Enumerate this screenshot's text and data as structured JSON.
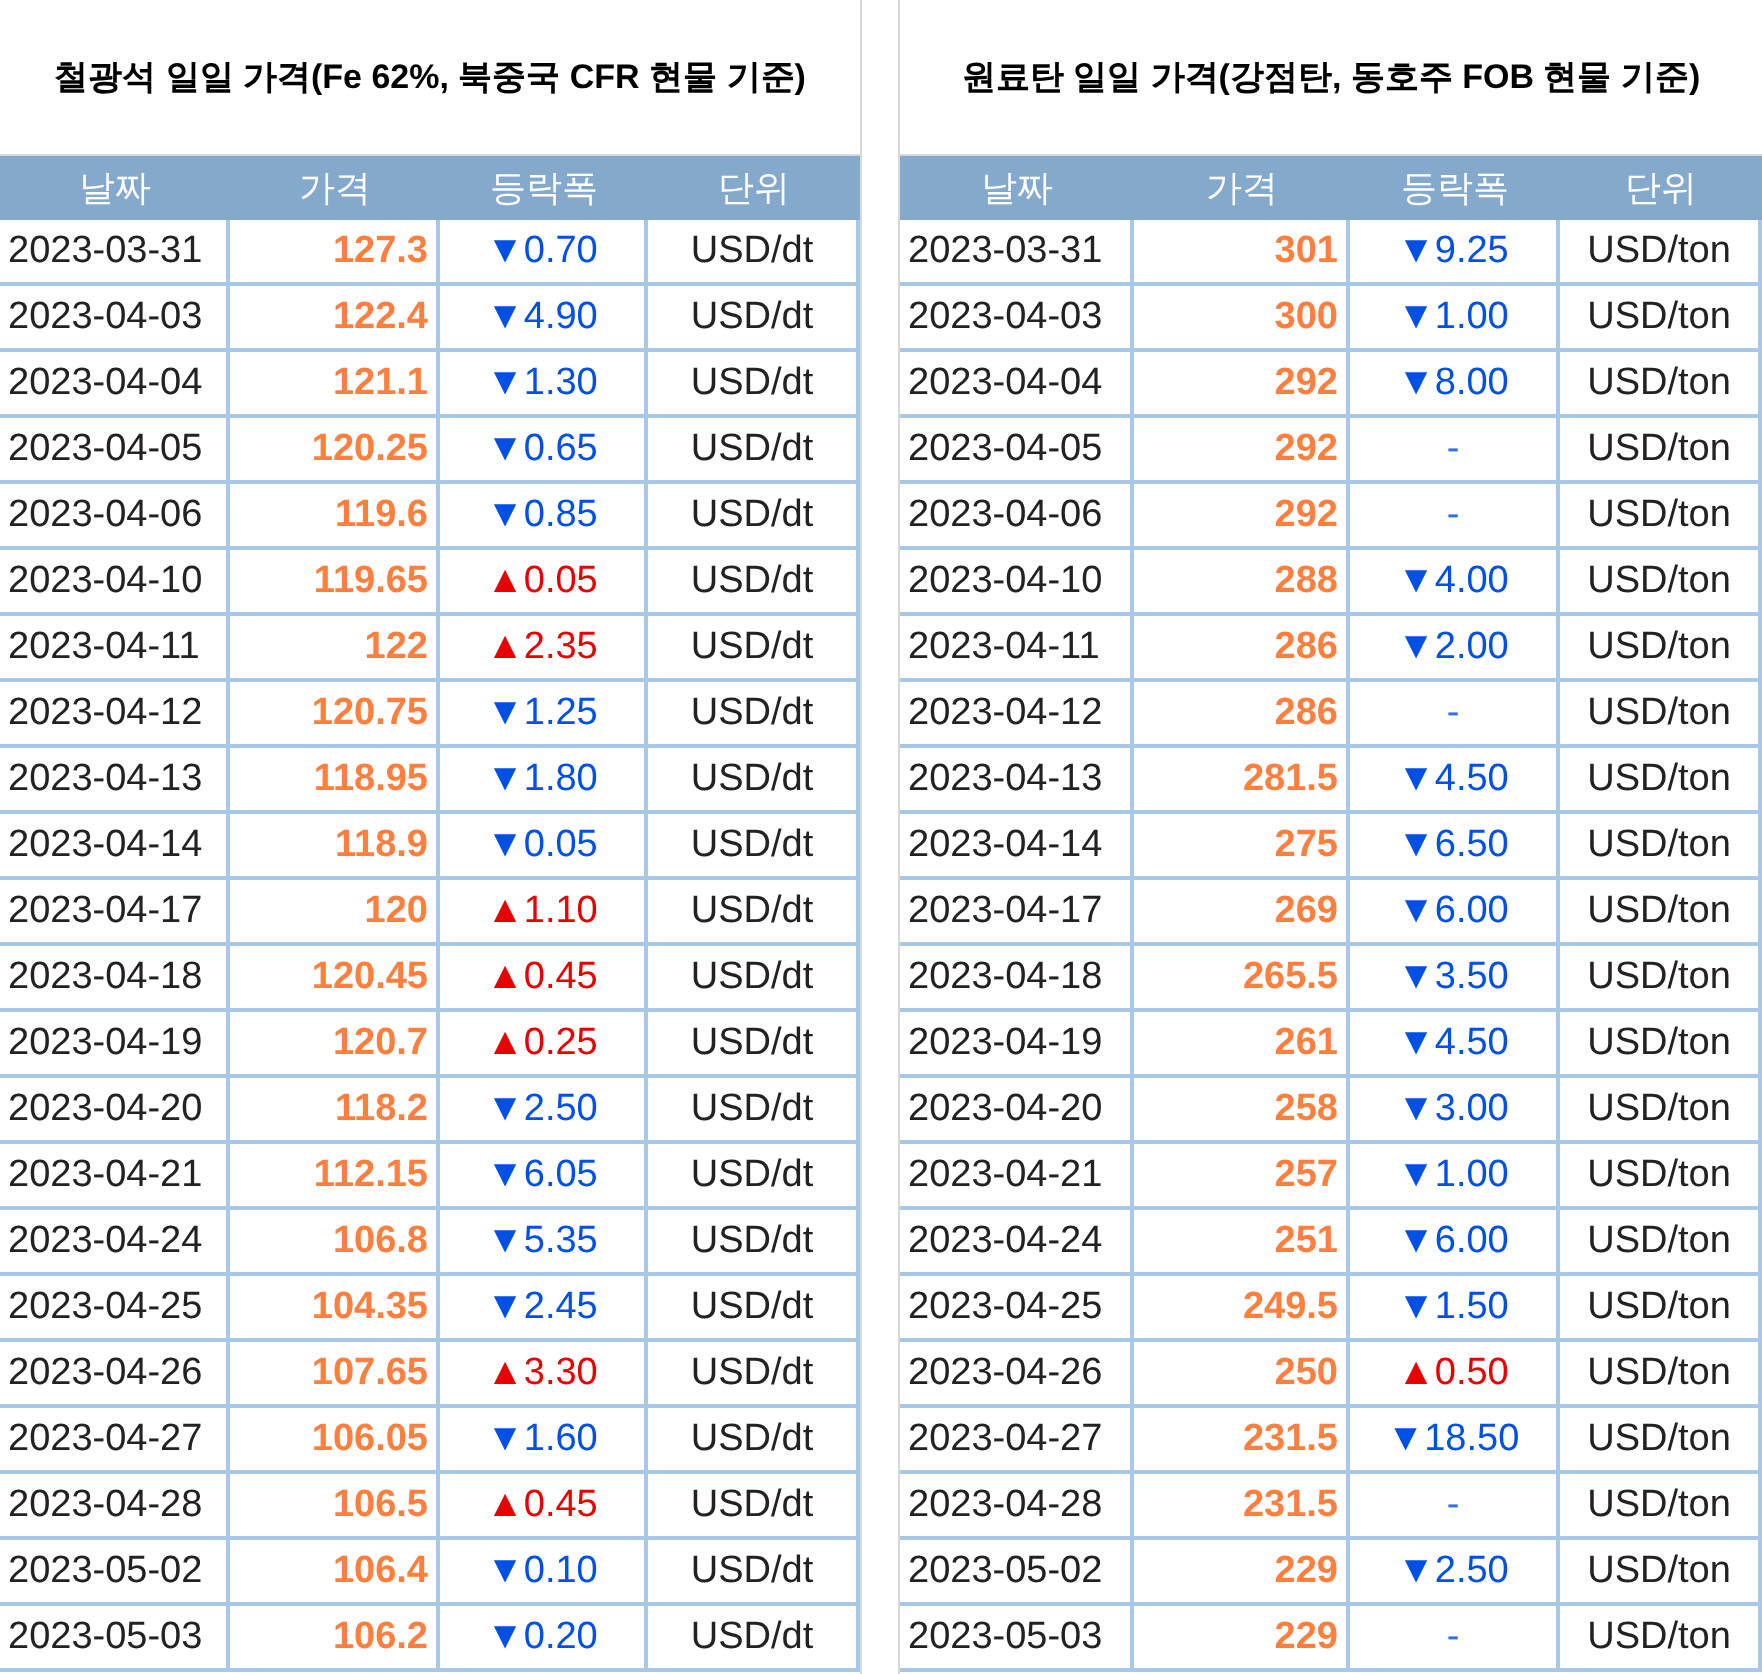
{
  "tables": [
    {
      "title": "철광석 일일 가격(Fe 62%, 북중국 CFR 현물 기준)",
      "columns": [
        "날짜",
        "가격",
        "등락폭",
        "단위"
      ],
      "rows": [
        {
          "date": "2023-03-31",
          "price": "127.3",
          "change": "▼0.70",
          "kind": "down",
          "unit": "USD/dt"
        },
        {
          "date": "2023-04-03",
          "price": "122.4",
          "change": "▼4.90",
          "kind": "down",
          "unit": "USD/dt"
        },
        {
          "date": "2023-04-04",
          "price": "121.1",
          "change": "▼1.30",
          "kind": "down",
          "unit": "USD/dt"
        },
        {
          "date": "2023-04-05",
          "price": "120.25",
          "change": "▼0.65",
          "kind": "down",
          "unit": "USD/dt"
        },
        {
          "date": "2023-04-06",
          "price": "119.6",
          "change": "▼0.85",
          "kind": "down",
          "unit": "USD/dt"
        },
        {
          "date": "2023-04-10",
          "price": "119.65",
          "change": "▲0.05",
          "kind": "up",
          "unit": "USD/dt"
        },
        {
          "date": "2023-04-11",
          "price": "122",
          "change": "▲2.35",
          "kind": "up",
          "unit": "USD/dt"
        },
        {
          "date": "2023-04-12",
          "price": "120.75",
          "change": "▼1.25",
          "kind": "down",
          "unit": "USD/dt"
        },
        {
          "date": "2023-04-13",
          "price": "118.95",
          "change": "▼1.80",
          "kind": "down",
          "unit": "USD/dt"
        },
        {
          "date": "2023-04-14",
          "price": "118.9",
          "change": "▼0.05",
          "kind": "down",
          "unit": "USD/dt"
        },
        {
          "date": "2023-04-17",
          "price": "120",
          "change": "▲1.10",
          "kind": "up",
          "unit": "USD/dt"
        },
        {
          "date": "2023-04-18",
          "price": "120.45",
          "change": "▲0.45",
          "kind": "up",
          "unit": "USD/dt"
        },
        {
          "date": "2023-04-19",
          "price": "120.7",
          "change": "▲0.25",
          "kind": "up",
          "unit": "USD/dt"
        },
        {
          "date": "2023-04-20",
          "price": "118.2",
          "change": "▼2.50",
          "kind": "down",
          "unit": "USD/dt"
        },
        {
          "date": "2023-04-21",
          "price": "112.15",
          "change": "▼6.05",
          "kind": "down",
          "unit": "USD/dt"
        },
        {
          "date": "2023-04-24",
          "price": "106.8",
          "change": "▼5.35",
          "kind": "down",
          "unit": "USD/dt"
        },
        {
          "date": "2023-04-25",
          "price": "104.35",
          "change": "▼2.45",
          "kind": "down",
          "unit": "USD/dt"
        },
        {
          "date": "2023-04-26",
          "price": "107.65",
          "change": "▲3.30",
          "kind": "up",
          "unit": "USD/dt"
        },
        {
          "date": "2023-04-27",
          "price": "106.05",
          "change": "▼1.60",
          "kind": "down",
          "unit": "USD/dt"
        },
        {
          "date": "2023-04-28",
          "price": "106.5",
          "change": "▲0.45",
          "kind": "up",
          "unit": "USD/dt"
        },
        {
          "date": "2023-05-02",
          "price": "106.4",
          "change": "▼0.10",
          "kind": "down",
          "unit": "USD/dt"
        },
        {
          "date": "2023-05-03",
          "price": "106.2",
          "change": "▼0.20",
          "kind": "down",
          "unit": "USD/dt"
        }
      ]
    },
    {
      "title": "원료탄 일일 가격(강점탄, 동호주 FOB 현물 기준)",
      "columns": [
        "날짜",
        "가격",
        "등락폭",
        "단위"
      ],
      "rows": [
        {
          "date": "2023-03-31",
          "price": "301",
          "change": "▼9.25",
          "kind": "down",
          "unit": "USD/ton"
        },
        {
          "date": "2023-04-03",
          "price": "300",
          "change": "▼1.00",
          "kind": "down",
          "unit": "USD/ton"
        },
        {
          "date": "2023-04-04",
          "price": "292",
          "change": "▼8.00",
          "kind": "down",
          "unit": "USD/ton"
        },
        {
          "date": "2023-04-05",
          "price": "292",
          "change": "-",
          "kind": "flat",
          "unit": "USD/ton"
        },
        {
          "date": "2023-04-06",
          "price": "292",
          "change": "-",
          "kind": "flat",
          "unit": "USD/ton"
        },
        {
          "date": "2023-04-10",
          "price": "288",
          "change": "▼4.00",
          "kind": "down",
          "unit": "USD/ton"
        },
        {
          "date": "2023-04-11",
          "price": "286",
          "change": "▼2.00",
          "kind": "down",
          "unit": "USD/ton"
        },
        {
          "date": "2023-04-12",
          "price": "286",
          "change": "-",
          "kind": "flat",
          "unit": "USD/ton"
        },
        {
          "date": "2023-04-13",
          "price": "281.5",
          "change": "▼4.50",
          "kind": "down",
          "unit": "USD/ton"
        },
        {
          "date": "2023-04-14",
          "price": "275",
          "change": "▼6.50",
          "kind": "down",
          "unit": "USD/ton"
        },
        {
          "date": "2023-04-17",
          "price": "269",
          "change": "▼6.00",
          "kind": "down",
          "unit": "USD/ton"
        },
        {
          "date": "2023-04-18",
          "price": "265.5",
          "change": "▼3.50",
          "kind": "down",
          "unit": "USD/ton"
        },
        {
          "date": "2023-04-19",
          "price": "261",
          "change": "▼4.50",
          "kind": "down",
          "unit": "USD/ton"
        },
        {
          "date": "2023-04-20",
          "price": "258",
          "change": "▼3.00",
          "kind": "down",
          "unit": "USD/ton"
        },
        {
          "date": "2023-04-21",
          "price": "257",
          "change": "▼1.00",
          "kind": "down",
          "unit": "USD/ton"
        },
        {
          "date": "2023-04-24",
          "price": "251",
          "change": "▼6.00",
          "kind": "down",
          "unit": "USD/ton"
        },
        {
          "date": "2023-04-25",
          "price": "249.5",
          "change": "▼1.50",
          "kind": "down",
          "unit": "USD/ton"
        },
        {
          "date": "2023-04-26",
          "price": "250",
          "change": "▲0.50",
          "kind": "up",
          "unit": "USD/ton"
        },
        {
          "date": "2023-04-27",
          "price": "231.5",
          "change": "▼18.50",
          "kind": "down",
          "unit": "USD/ton"
        },
        {
          "date": "2023-04-28",
          "price": "231.5",
          "change": "-",
          "kind": "flat",
          "unit": "USD/ton"
        },
        {
          "date": "2023-05-02",
          "price": "229",
          "change": "▼2.50",
          "kind": "down",
          "unit": "USD/ton"
        },
        {
          "date": "2023-05-03",
          "price": "229",
          "change": "-",
          "kind": "flat",
          "unit": "USD/ton"
        }
      ]
    }
  ]
}
